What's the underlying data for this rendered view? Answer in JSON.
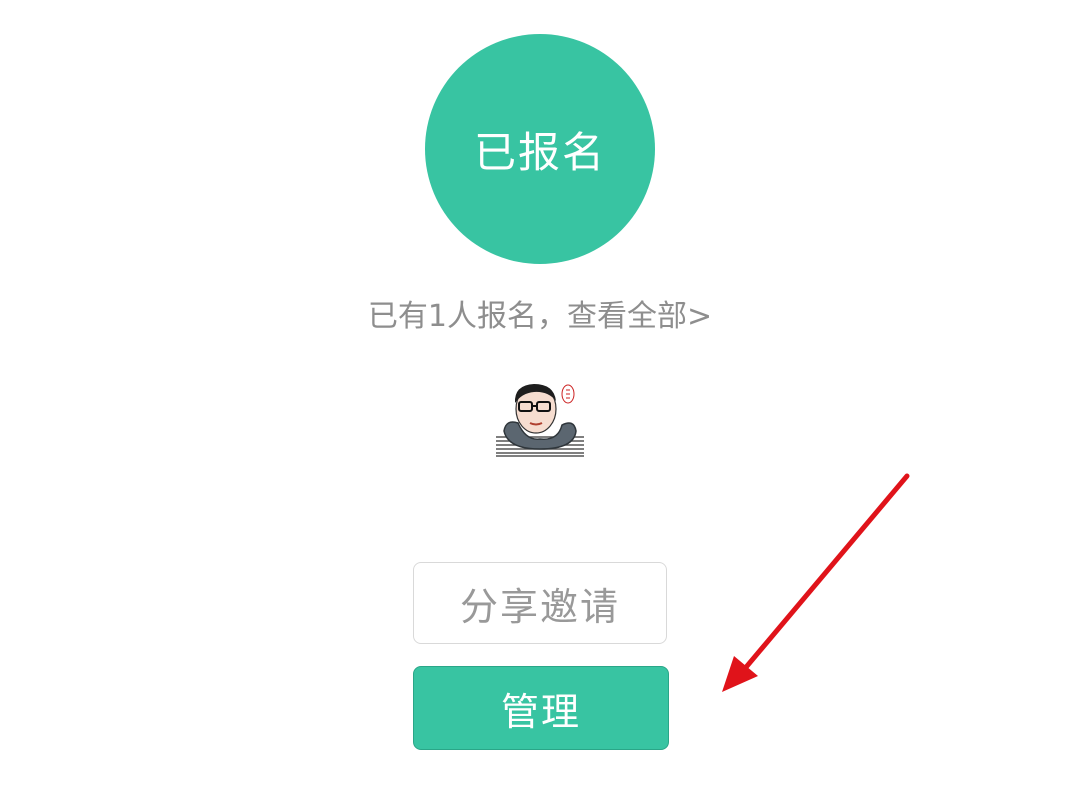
{
  "status": {
    "label": "已报名"
  },
  "registrants": {
    "summary": "已有1人报名，查看全部>"
  },
  "avatar": {
    "icon": "user-avatar-illustration"
  },
  "actions": {
    "share_label": "分享邀请",
    "manage_label": "管理"
  },
  "colors": {
    "accent": "#38c4a2",
    "annotation_arrow": "#e0131a",
    "muted_text": "#8e8e8e"
  }
}
